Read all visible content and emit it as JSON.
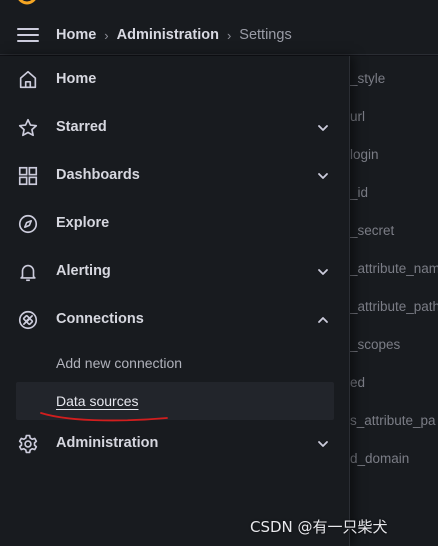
{
  "breadcrumb": {
    "items": [
      "Home",
      "Administration",
      "Settings"
    ],
    "separator": "›"
  },
  "sidebar": {
    "items": [
      {
        "label": "Home",
        "icon": "home-icon",
        "chevron": "none"
      },
      {
        "label": "Starred",
        "icon": "star-icon",
        "chevron": "down"
      },
      {
        "label": "Dashboards",
        "icon": "grid-icon",
        "chevron": "down"
      },
      {
        "label": "Explore",
        "icon": "compass-icon",
        "chevron": "none"
      },
      {
        "label": "Alerting",
        "icon": "bell-icon",
        "chevron": "down"
      },
      {
        "label": "Connections",
        "icon": "connections-icon",
        "chevron": "up",
        "expanded": true
      },
      {
        "label": "Administration",
        "icon": "gear-icon",
        "chevron": "down"
      }
    ],
    "connections_children": [
      {
        "label": "Add new connection",
        "active": false
      },
      {
        "label": "Data sources",
        "active": true
      }
    ]
  },
  "background_rows": [
    "_style",
    "url",
    "login",
    "_id",
    "_secret",
    "_attribute_name",
    "_attribute_path",
    "_scopes",
    "ed",
    "s_attribute_pa",
    "d_domain"
  ],
  "watermark": "CSDN @有一只柴犬",
  "colors": {
    "background": "#111217",
    "panel": "#181b1f",
    "text": "#d6d7df",
    "muted": "#b0b2bb",
    "annotation": "#d21e1e",
    "logo": "#f5a623"
  }
}
